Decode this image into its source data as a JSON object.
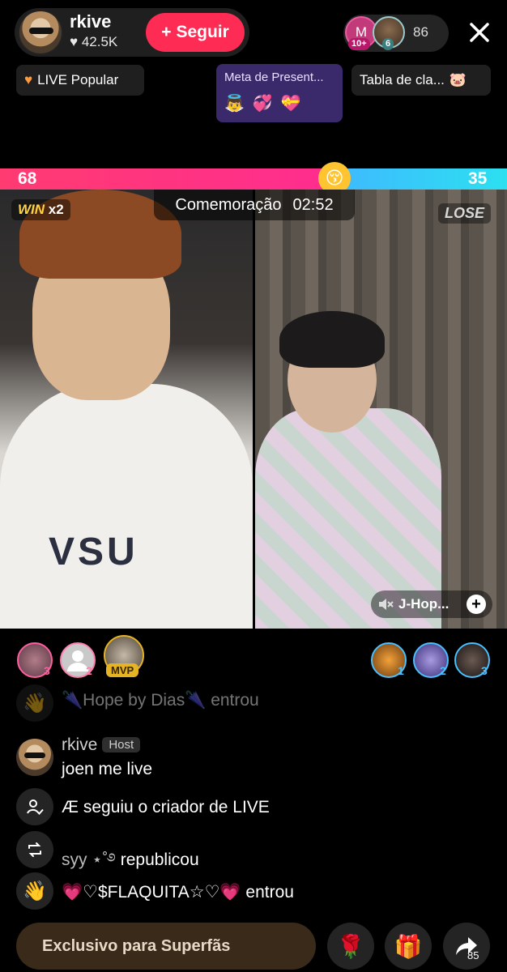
{
  "host": {
    "name": "rkive",
    "likes": "♥ 42.5K",
    "follow_label": "Seguir"
  },
  "viewers": {
    "badge1_level": "10+",
    "badge1_letter": "M",
    "badge2_level": "6",
    "count": "86"
  },
  "chips": {
    "live_popular": "LIVE Popular",
    "gift_goal_title": "Meta de Present...",
    "ranking": "Tabla de cla..."
  },
  "battle": {
    "left_score": "68",
    "right_score": "35",
    "left_fraction": 0.66,
    "win_word": "WIN",
    "win_mult": "x2",
    "lose_label": "LOSE",
    "timer_label": "Comemoração",
    "timer_value": "02:52",
    "guest_name": "J-Hop...",
    "shirt_print": "VSU"
  },
  "supporters_left": [
    {
      "rank": "3"
    },
    {
      "rank": "2"
    },
    {
      "rank": "MVP"
    }
  ],
  "supporters_right": [
    {
      "rank": "1"
    },
    {
      "rank": "2"
    },
    {
      "rank": "3"
    }
  ],
  "chat": [
    {
      "type": "join",
      "text": "🌂Hope by Dias🌂 entrou",
      "faded": true
    },
    {
      "type": "message",
      "user": "rkive",
      "tag": "Host",
      "text": "joen me live"
    },
    {
      "type": "follow",
      "text": "Æ seguiu o criador de LIVE"
    },
    {
      "type": "repost",
      "user": "syy ⋆˚࿔",
      "text": "republicou"
    },
    {
      "type": "join",
      "text": "💗♡$FLAQUITA☆♡💗 entrou"
    }
  ],
  "bottom": {
    "superfans_label": "Exclusivo para Superfãs",
    "share_count": "85"
  },
  "colors": {
    "follow": "#fe2c55",
    "score_red": "#ff2d8f",
    "score_blue": "#2ce0f0",
    "gift_goal_bg": "#3b2a6b"
  }
}
